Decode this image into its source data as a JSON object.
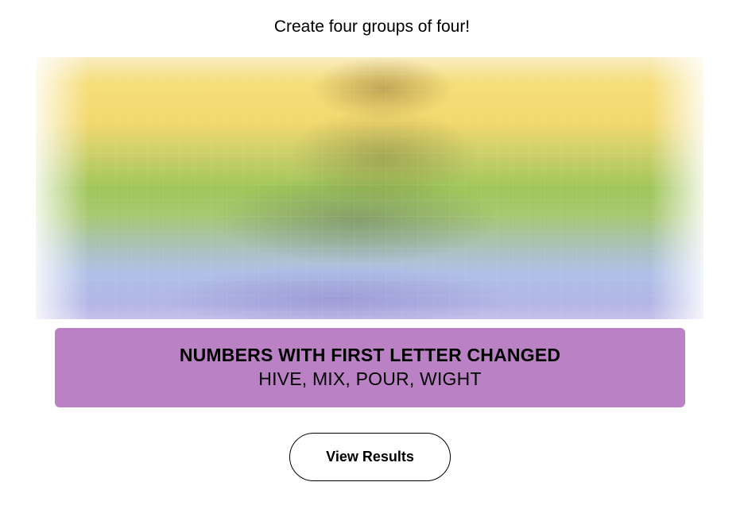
{
  "instructions": "Create four groups of four!",
  "solved_group": {
    "title": "NUMBERS WITH FIRST LETTER CHANGED",
    "members": "HIVE, MIX, POUR, WIGHT",
    "color": "#ba81c5"
  },
  "board": {
    "state": "blurred",
    "colors": [
      "#f6de7a",
      "#a0c35a",
      "#b0c4ef"
    ]
  },
  "actions": {
    "view_results_label": "View Results"
  }
}
